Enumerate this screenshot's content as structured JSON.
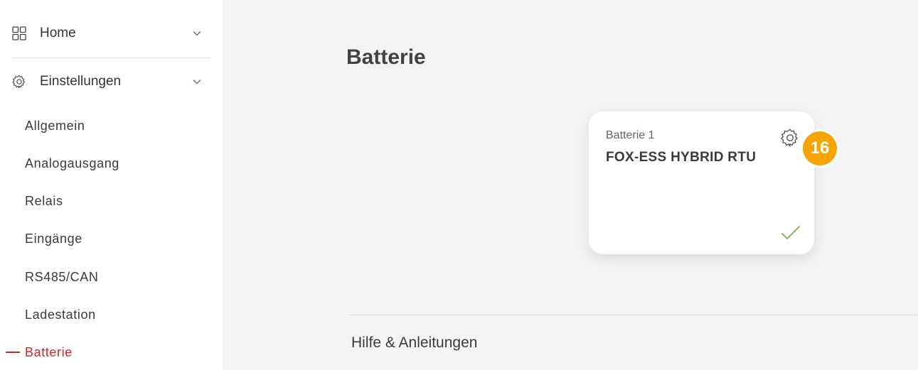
{
  "sidebar": {
    "home": {
      "label": "Home",
      "icon": "grid-icon"
    },
    "settings": {
      "label": "Einstellungen",
      "icon": "gear-icon"
    },
    "sub_items": [
      {
        "label": "Allgemein"
      },
      {
        "label": "Analogausgang"
      },
      {
        "label": "Relais"
      },
      {
        "label": "Eingänge"
      },
      {
        "label": "RS485/CAN"
      },
      {
        "label": "Ladestation"
      },
      {
        "label": "Batterie",
        "active": true
      }
    ],
    "active_color": "#c62828"
  },
  "main": {
    "title": "Batterie",
    "card": {
      "subtitle": "Batterie 1",
      "title": "FOX-ESS HYBRID RTU",
      "settings_icon": "gear-icon",
      "status_icon": "check-icon",
      "status_color": "#7cb342"
    },
    "badge": {
      "value": "16",
      "color": "#f5a400"
    },
    "help_label": "Hilfe & Anleitungen"
  }
}
